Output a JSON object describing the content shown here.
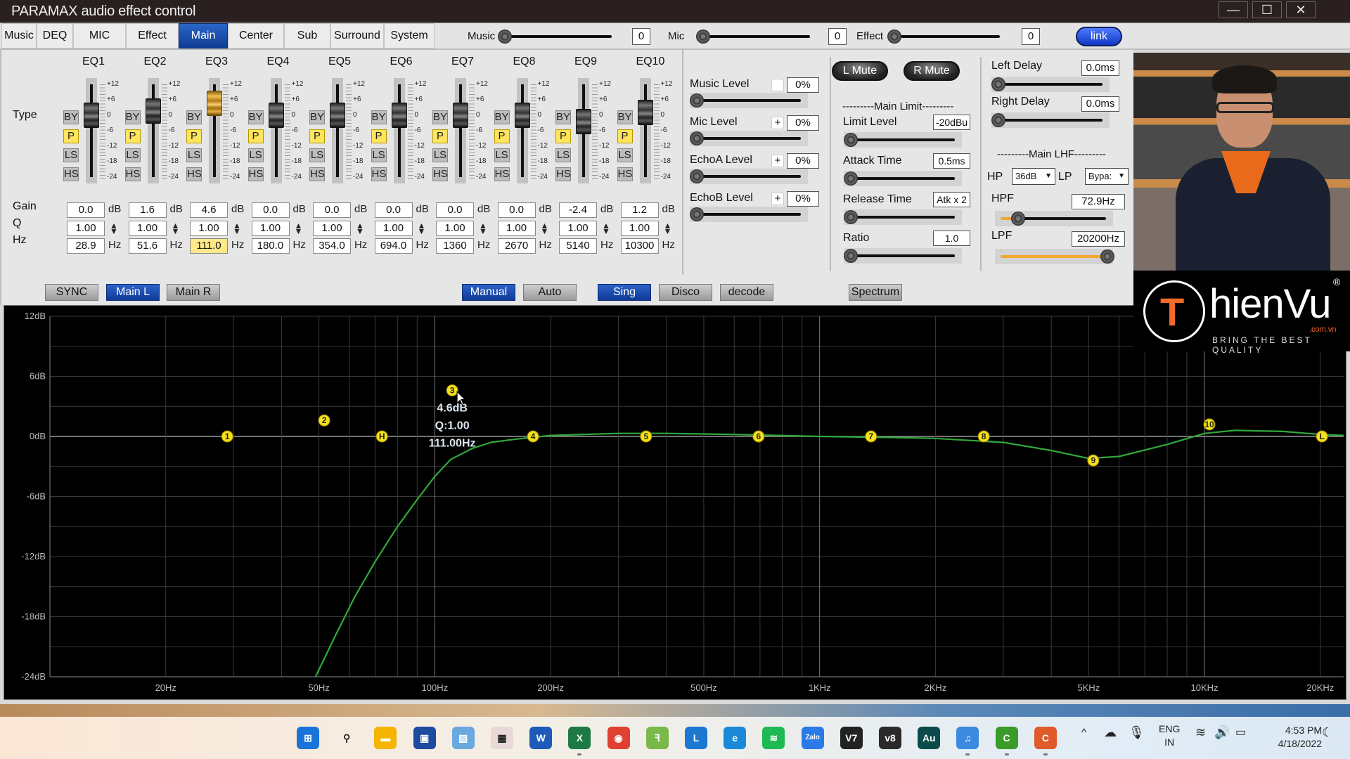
{
  "window": {
    "title": "PARAMAX audio effect control",
    "controls": {
      "minimize": "—",
      "maximize": "☐",
      "close": "✕"
    }
  },
  "tabs": [
    {
      "label": "Music",
      "active": false
    },
    {
      "label": "DEQ",
      "active": false
    },
    {
      "label": "MIC",
      "active": false
    },
    {
      "label": "Effect",
      "active": false
    },
    {
      "label": "Main",
      "active": true
    },
    {
      "label": "Center",
      "active": false
    },
    {
      "label": "Sub",
      "active": false
    },
    {
      "label": "Surround",
      "active": false
    },
    {
      "label": "System",
      "active": false
    }
  ],
  "top_sliders": [
    {
      "label": "Music",
      "value": "0"
    },
    {
      "label": "Mic",
      "value": "0"
    },
    {
      "label": "Effect",
      "value": "0"
    }
  ],
  "link_label": "link",
  "eq": {
    "type_label": "Type",
    "gain_label": "Gain",
    "q_label": "Q",
    "hz_label": "Hz",
    "db_unit": "dB",
    "hz_unit": "Hz",
    "type_buttons": [
      "BY",
      "P",
      "LS",
      "HS"
    ],
    "scale_labels": [
      "+12",
      "+6",
      "0",
      "-6",
      "-12",
      "-18",
      "-24"
    ],
    "bands": [
      {
        "name": "EQ1",
        "gain": "0.0",
        "q": "1.00",
        "hz": "28.9",
        "type": "P",
        "gain_db": 0.0,
        "freq": 28.9
      },
      {
        "name": "EQ2",
        "gain": "1.6",
        "q": "1.00",
        "hz": "51.6",
        "type": "P",
        "gain_db": 1.6,
        "freq": 51.6
      },
      {
        "name": "EQ3",
        "gain": "4.6",
        "q": "1.00",
        "hz": "111.0",
        "type": "P",
        "gain_db": 4.6,
        "freq": 111.0,
        "selected": true
      },
      {
        "name": "EQ4",
        "gain": "0.0",
        "q": "1.00",
        "hz": "180.0",
        "type": "P",
        "gain_db": 0.0,
        "freq": 180.0
      },
      {
        "name": "EQ5",
        "gain": "0.0",
        "q": "1.00",
        "hz": "354.0",
        "type": "P",
        "gain_db": 0.0,
        "freq": 354.0
      },
      {
        "name": "EQ6",
        "gain": "0.0",
        "q": "1.00",
        "hz": "694.0",
        "type": "P",
        "gain_db": 0.0,
        "freq": 694.0
      },
      {
        "name": "EQ7",
        "gain": "0.0",
        "q": "1.00",
        "hz": "1360",
        "type": "P",
        "gain_db": 0.0,
        "freq": 1360
      },
      {
        "name": "EQ8",
        "gain": "0.0",
        "q": "1.00",
        "hz": "2670",
        "type": "P",
        "gain_db": 0.0,
        "freq": 2670
      },
      {
        "name": "EQ9",
        "gain": "-2.4",
        "q": "1.00",
        "hz": "5140",
        "type": "P",
        "gain_db": -2.4,
        "freq": 5140
      },
      {
        "name": "EQ10",
        "gain": "1.2",
        "q": "1.00",
        "hz": "10300",
        "type": "P",
        "gain_db": 1.2,
        "freq": 10300
      }
    ]
  },
  "levels": [
    {
      "label": "Music Level",
      "toggle": "",
      "value": "0%"
    },
    {
      "label": "Mic Level",
      "toggle": "+",
      "value": "0%"
    },
    {
      "label": "EchoA Level",
      "toggle": "+",
      "value": "0%"
    },
    {
      "label": "EchoB Level",
      "toggle": "+",
      "value": "0%"
    }
  ],
  "mute": {
    "left": "L Mute",
    "right": "R Mute"
  },
  "main_limit": {
    "title": "---------Main Limit---------",
    "params": [
      {
        "label": "Limit Level",
        "value": "-20dBu"
      },
      {
        "label": "Attack Time",
        "value": "0.5ms"
      },
      {
        "label": "Release Time",
        "value": "Atk x 2"
      },
      {
        "label": "Ratio",
        "value": "1.0"
      }
    ]
  },
  "delay": [
    {
      "label": "Left Delay",
      "value": "0.0ms"
    },
    {
      "label": "Right Delay",
      "value": "0.0ms"
    }
  ],
  "main_lhf": {
    "title": "---------Main LHF---------",
    "hp_label": "HP",
    "hp_slope": "36dB",
    "lp_label": "LP",
    "lp_slope": "Bypa:",
    "hpf_label": "HPF",
    "hpf_value": "72.9Hz",
    "hpf_position": 0.15,
    "lpf_label": "LPF",
    "lpf_value": "20200Hz",
    "lpf_position": 1.0
  },
  "buttons": {
    "sync": "SYNC",
    "main_l": "Main L",
    "main_r": "Main R",
    "manual": "Manual",
    "auto": "Auto",
    "sing": "Sing",
    "disco": "Disco",
    "decode": "decode",
    "spectrum": "Spectrum"
  },
  "chart_data": {
    "type": "line",
    "title": "",
    "xlabel": "",
    "ylabel": "",
    "xscale": "log",
    "xlim": [
      10,
      23000
    ],
    "ylim": [
      -24,
      12
    ],
    "grid": true,
    "y_ticks": [
      "12dB",
      "6dB",
      "0dB",
      "-6dB",
      "-12dB",
      "-18dB",
      "-24dB"
    ],
    "y_tick_values": [
      12,
      6,
      0,
      -6,
      -12,
      -18,
      -24
    ],
    "x_ticks": [
      "20Hz",
      "50Hz",
      "100Hz",
      "200Hz",
      "500Hz",
      "1KHz",
      "2KHz",
      "5KHz",
      "10KHz",
      "20KHz"
    ],
    "x_tick_values": [
      20,
      50,
      100,
      200,
      500,
      1000,
      2000,
      5000,
      10000,
      20000
    ],
    "curve_color": "#2fa83a",
    "markers": [
      {
        "label": "1",
        "freq": 28.9,
        "gain": 0.0
      },
      {
        "label": "2",
        "freq": 51.6,
        "gain": 1.6
      },
      {
        "label": "H",
        "freq": 72.9,
        "gain": 0.0
      },
      {
        "label": "3",
        "freq": 111.0,
        "gain": 4.6
      },
      {
        "label": "4",
        "freq": 180.0,
        "gain": 0.0
      },
      {
        "label": "5",
        "freq": 354.0,
        "gain": 0.0
      },
      {
        "label": "6",
        "freq": 694.0,
        "gain": 0.0
      },
      {
        "label": "7",
        "freq": 1360,
        "gain": 0.0
      },
      {
        "label": "8",
        "freq": 2670,
        "gain": 0.0
      },
      {
        "label": "9",
        "freq": 5140,
        "gain": -2.4
      },
      {
        "label": "10",
        "freq": 10300,
        "gain": 1.2
      },
      {
        "label": "L",
        "freq": 20200,
        "gain": 0.0
      }
    ],
    "curve": {
      "name": "Main response",
      "x": [
        49,
        55,
        62,
        70,
        80,
        90,
        100,
        110,
        125,
        140,
        160,
        200,
        300,
        400,
        600,
        1000,
        1500,
        2000,
        3000,
        4000,
        5000,
        6000,
        8000,
        10000,
        12000,
        16000,
        20000,
        23000
      ],
      "y": [
        -24,
        -20,
        -16,
        -12.5,
        -9,
        -6.3,
        -4,
        -2.3,
        -1.2,
        -0.6,
        -0.3,
        0.1,
        0.3,
        0.3,
        0.2,
        0.0,
        -0.1,
        -0.2,
        -0.6,
        -1.4,
        -2.2,
        -2.0,
        -0.8,
        0.3,
        0.6,
        0.5,
        0.2,
        0.1
      ]
    },
    "tooltip": {
      "gain": "4.6dB",
      "q": "Q:1.00",
      "freq": "111.00Hz"
    }
  },
  "watermark": {
    "brand": "hienVu",
    "initial": "T",
    "domain": ".com.vn",
    "tagline": "BRING THE BEST QUALITY",
    "registered": "®"
  },
  "taskbar": {
    "apps": [
      {
        "name": "start",
        "glyph": "⊞",
        "color": "#1a73d8",
        "running": false
      },
      {
        "name": "search",
        "glyph": "⚲",
        "color": "transparent",
        "running": false
      },
      {
        "name": "file-explorer",
        "glyph": "▬",
        "color": "#f4b400",
        "running": false
      },
      {
        "name": "microsoft-store",
        "glyph": "▣",
        "color": "#1e4aa0",
        "running": false
      },
      {
        "name": "paint",
        "glyph": "▧",
        "color": "#6aa8e0",
        "running": false
      },
      {
        "name": "mahjong",
        "glyph": "▦",
        "color": "#e8d8d8",
        "running": false
      },
      {
        "name": "word",
        "glyph": "W",
        "color": "#1e5bb8",
        "running": false
      },
      {
        "name": "excel",
        "glyph": "X",
        "color": "#1d7a44",
        "running": true
      },
      {
        "name": "chrome",
        "glyph": "◉",
        "color": "#e04030",
        "running": false
      },
      {
        "name": "coccoc",
        "glyph": "ꟻ",
        "color": "#7ab84a",
        "running": false
      },
      {
        "name": "lingoes",
        "glyph": "L",
        "color": "#1a78d0",
        "running": false
      },
      {
        "name": "edge",
        "glyph": "e",
        "color": "#1a8ad8",
        "running": false
      },
      {
        "name": "spotify",
        "glyph": "≋",
        "color": "#1db954",
        "running": false
      },
      {
        "name": "zalo",
        "glyph": "Zalo",
        "color": "#2a7ae8",
        "running": false
      },
      {
        "name": "v7",
        "glyph": "V7",
        "color": "#222222",
        "running": false
      },
      {
        "name": "v8",
        "glyph": "v8",
        "color": "#2a2a2a",
        "running": false
      },
      {
        "name": "audition",
        "glyph": "Au",
        "color": "#0a4a4a",
        "running": false
      },
      {
        "name": "music-player",
        "glyph": "♫",
        "color": "#3a8ae0",
        "running": true
      },
      {
        "name": "camtasia-green",
        "glyph": "C",
        "color": "#3a9a2a",
        "running": true
      },
      {
        "name": "camtasia-orange",
        "glyph": "C",
        "color": "#e05a2a",
        "running": true
      }
    ],
    "tray": {
      "chevron": "^",
      "language": "ENG",
      "region": "IN",
      "time": "4:53 PM",
      "date": "4/18/2022"
    }
  }
}
